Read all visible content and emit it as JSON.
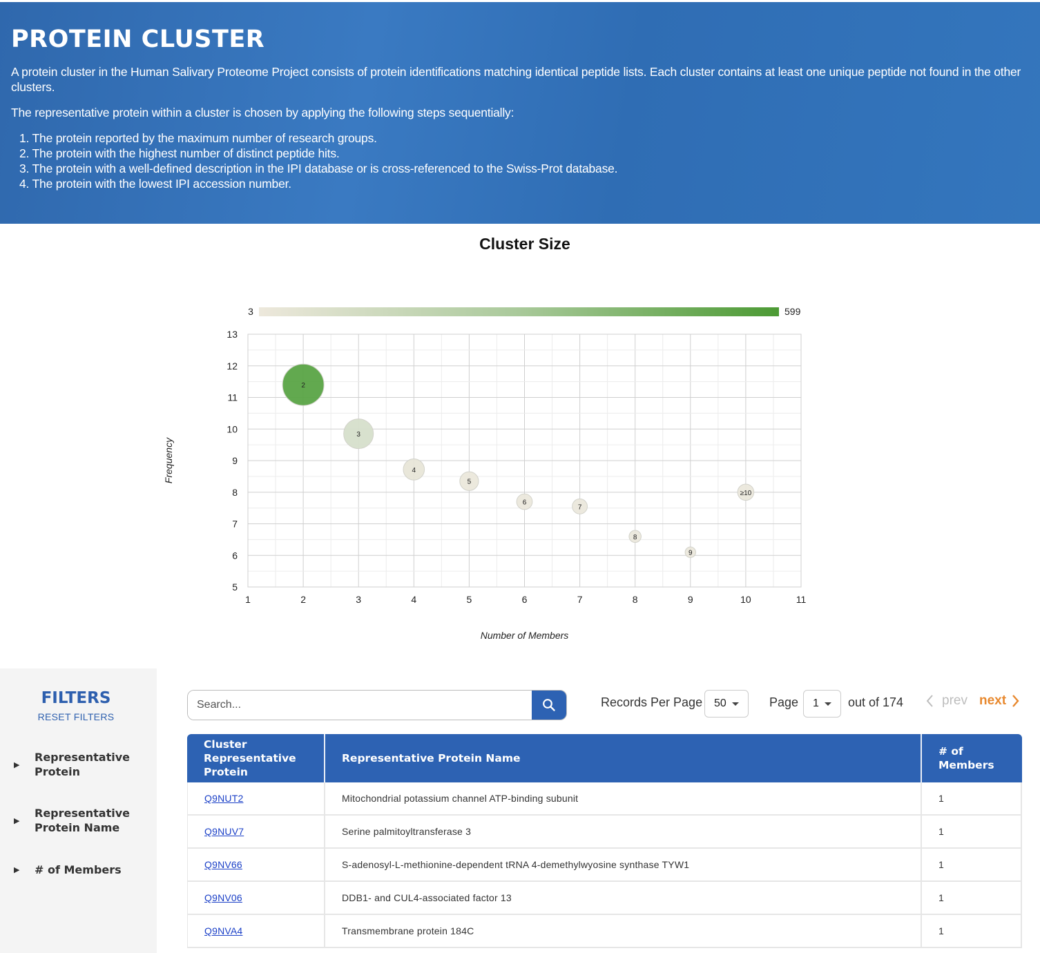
{
  "header": {
    "title": "PROTEIN CLUSTER",
    "paragraph1": "A protein cluster in the Human Salivary Proteome Project consists of protein identifications matching identical peptide lists. Each cluster contains at least one unique peptide not found in the other clusters.",
    "paragraph2": "The representative protein within a cluster is chosen by applying the following steps sequentially:",
    "steps": [
      "1. The protein reported by the maximum number of research groups.",
      "2. The protein with the highest number of distinct peptide hits.",
      "3. The protein with a well-defined description in the IPI database or is cross-referenced to the Swiss-Prot database.",
      "4. The protein with the lowest IPI accession number."
    ]
  },
  "chart_data": {
    "type": "scatter",
    "title": "Cluster Size",
    "xlabel": "Number of Members",
    "ylabel": "Frequency",
    "xlim": [
      1,
      11
    ],
    "ylim": [
      5,
      13
    ],
    "x_ticks": [
      "1",
      "2",
      "3",
      "4",
      "5",
      "6",
      "7",
      "8",
      "9",
      "10",
      "11"
    ],
    "y_ticks": [
      "5",
      "6",
      "7",
      "8",
      "9",
      "10",
      "11",
      "12",
      "13"
    ],
    "colorbar": {
      "min_label": "3",
      "max_label": "599",
      "min_color": "#ede8dc",
      "max_color": "#4c9a34"
    },
    "points": [
      {
        "x": 2,
        "y": 11.4,
        "label": "2",
        "size": 599,
        "color": "#5aa546"
      },
      {
        "x": 3,
        "y": 9.85,
        "label": "3",
        "size": 250,
        "color": "#d6e0cc"
      },
      {
        "x": 4,
        "y": 8.72,
        "label": "4",
        "size": 90,
        "color": "#e8e6d9"
      },
      {
        "x": 5,
        "y": 8.35,
        "label": "5",
        "size": 60,
        "color": "#ebe8dc"
      },
      {
        "x": 6,
        "y": 7.7,
        "label": "6",
        "size": 30,
        "color": "#ece8dd"
      },
      {
        "x": 7,
        "y": 7.55,
        "label": "7",
        "size": 25,
        "color": "#ece8dd"
      },
      {
        "x": 8,
        "y": 6.6,
        "label": "8",
        "size": 8,
        "color": "#ece8dd"
      },
      {
        "x": 9,
        "y": 6.1,
        "label": "9",
        "size": 3,
        "color": "#ece8dd"
      },
      {
        "x": 10,
        "y": 8.0,
        "label": "≥10",
        "size": 35,
        "color": "#ece8dd"
      }
    ]
  },
  "filters": {
    "title": "FILTERS",
    "reset_label": "RESET FILTERS",
    "items": [
      {
        "label": "Representative Protein"
      },
      {
        "label": "Representative Protein Name"
      },
      {
        "label": "# of Members"
      }
    ]
  },
  "toolbar": {
    "search_placeholder": "Search...",
    "records_label": "Records Per Page",
    "records_value": "50",
    "page_label": "Page",
    "page_value": "1",
    "out_of_label": "out of 174",
    "prev_label": "prev",
    "next_label": "next"
  },
  "table": {
    "headers": [
      "Cluster Representative Protein",
      "Representative Protein Name",
      "# of Members"
    ],
    "rows": [
      {
        "id": "Q9NUT2",
        "name": "Mitochondrial potassium channel ATP-binding subunit",
        "members": "1"
      },
      {
        "id": "Q9NUV7",
        "name": "Serine palmitoyltransferase 3",
        "members": "1"
      },
      {
        "id": "Q9NV66",
        "name": "S-adenosyl-L-methionine-dependent tRNA 4-demethylwyosine synthase TYW1",
        "members": "1"
      },
      {
        "id": "Q9NV06",
        "name": "DDB1- and CUL4-associated factor 13",
        "members": "1"
      },
      {
        "id": "Q9NVA4",
        "name": "Transmembrane protein 184C",
        "members": "1"
      }
    ]
  }
}
